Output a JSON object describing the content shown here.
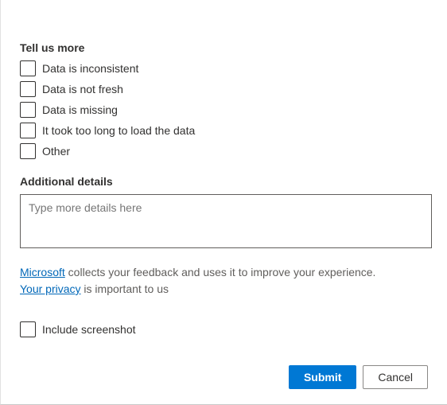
{
  "tellUsMore": {
    "heading": "Tell us more",
    "options": [
      {
        "label": "Data is inconsistent"
      },
      {
        "label": "Data is not fresh"
      },
      {
        "label": "Data is missing"
      },
      {
        "label": "It took too long to load the data"
      },
      {
        "label": "Other"
      }
    ]
  },
  "additionalDetails": {
    "heading": "Additional details",
    "placeholder": "Type more details here"
  },
  "disclosure": {
    "link1": "Microsoft",
    "text1": " collects your feedback and uses it to improve your experience. ",
    "link2": "Your privacy",
    "text2": " is important to us"
  },
  "includeScreenshot": {
    "label": "Include screenshot"
  },
  "buttons": {
    "submit": "Submit",
    "cancel": "Cancel"
  }
}
